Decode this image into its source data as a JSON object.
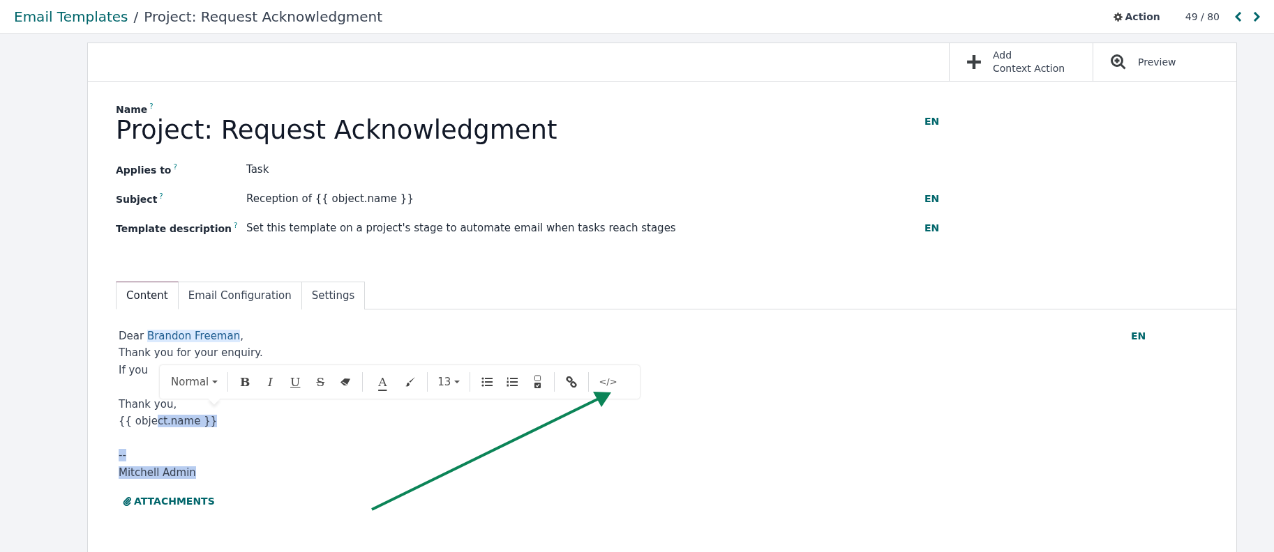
{
  "breadcrumb": [
    {
      "label": "Email Templates",
      "kind": "link"
    },
    {
      "label": "Project: Request Acknowledgment",
      "kind": "current"
    }
  ],
  "breadcrumb_separator": "/",
  "action_button": "Action",
  "pager": "49 / 80",
  "button_box": [
    {
      "kind": "add",
      "lines": [
        "Add",
        "Context Action"
      ]
    },
    {
      "kind": "preview",
      "lines": [
        "Preview"
      ]
    }
  ],
  "form": {
    "name_label": "Name",
    "help_mark": "?",
    "name": "Project: Request Acknowledgment",
    "name_lang": "EN",
    "fields": [
      {
        "label": "Applies to",
        "value": "Task"
      },
      {
        "label": "Subject",
        "value": "Reception of {{ object.name }}",
        "lang": "EN"
      },
      {
        "label": "Template description",
        "value": "Set this template on a project's stage to automate email when tasks reach stages",
        "lang": "EN"
      }
    ]
  },
  "tabs": [
    {
      "label": "Content",
      "selected": true
    },
    {
      "label": "Email Configuration",
      "selected": false
    },
    {
      "label": "Settings",
      "selected": false
    }
  ],
  "body_lang": "EN",
  "body_lines": [
    {
      "gap_before": false,
      "segments": [
        {
          "text": "Dear ",
          "kind": "plain"
        },
        {
          "text": "Brandon Freeman",
          "kind": "placeholder"
        },
        {
          "text": ",",
          "kind": "plain"
        }
      ]
    },
    {
      "gap_before": false,
      "segments": [
        {
          "text": "Thank you for your enquiry.",
          "kind": "plain"
        }
      ]
    },
    {
      "gap_before": false,
      "segments": [
        {
          "text": "If you",
          "kind": "plain"
        }
      ]
    },
    {
      "gap_before": true,
      "segments": [
        {
          "text": "Thank you,",
          "kind": "plain"
        }
      ]
    },
    {
      "gap_before": false,
      "segments": [
        {
          "text": "{{ obje",
          "kind": "plain"
        },
        {
          "text": "ct.name }}",
          "kind": "selection"
        }
      ]
    },
    {
      "gap_before": true,
      "segments": [
        {
          "text": "--",
          "kind": "selection"
        }
      ]
    },
    {
      "gap_before": false,
      "segments": [
        {
          "text": "Mitchell Admin ",
          "kind": "selection"
        }
      ]
    }
  ],
  "attachments": "ATTACHMENTS",
  "toolbar": {
    "style_dropdown": "Normal",
    "format_glyphs": [
      "B",
      "I",
      "U",
      "S"
    ],
    "color_glyph": "A",
    "size_dropdown": "13",
    "code_glyph": "</>"
  }
}
